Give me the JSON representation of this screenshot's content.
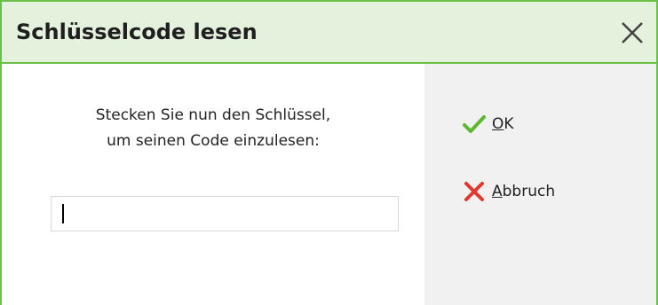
{
  "dialog": {
    "title": "Schlüsselcode lesen",
    "prompt_line1": "Stecken Sie nun den Schlüssel,",
    "prompt_line2": "um seinen Code einzulesen:",
    "code_value": "",
    "buttons": {
      "ok": {
        "mnemonic": "O",
        "rest": "K"
      },
      "cancel": {
        "mnemonic": "A",
        "rest": "bbruch"
      }
    },
    "icons": {
      "close": "close-icon",
      "ok": "checkmark-icon",
      "cancel": "cross-icon"
    },
    "colors": {
      "accent_green": "#6cc04a",
      "titlebar_bg": "#e4f1dc",
      "check_green": "#5cb82e",
      "cross_red": "#e0382d"
    }
  }
}
